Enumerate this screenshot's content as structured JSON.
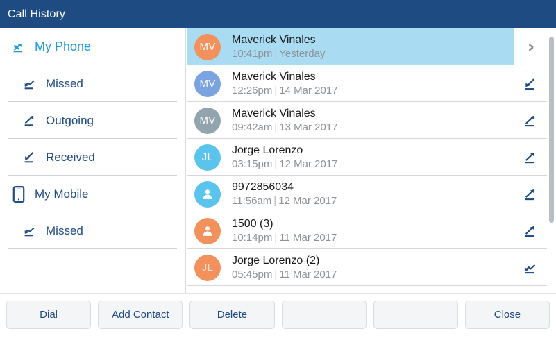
{
  "window": {
    "title": "Call History"
  },
  "colors": {
    "header_bg": "#1f4b83",
    "accent_blue": "#1e9cd7",
    "nav_text": "#1f4b83",
    "selected_row": "#a9dcf2",
    "avatar_orange": "#f2915c",
    "avatar_blue": "#7ba3e0",
    "avatar_gray": "#92a5ae",
    "avatar_cyan": "#5bc4ec",
    "softkey_text": "#1f4b83"
  },
  "sidebar": {
    "items": [
      {
        "label": "My Phone",
        "icon": "all-calls-icon",
        "indent": false,
        "selected": true
      },
      {
        "label": "Missed",
        "icon": "missed-call-icon",
        "indent": true,
        "selected": false
      },
      {
        "label": "Outgoing",
        "icon": "outgoing-call-icon",
        "indent": true,
        "selected": false
      },
      {
        "label": "Received",
        "icon": "received-call-icon",
        "indent": true,
        "selected": false
      },
      {
        "label": "My Mobile",
        "icon": "mobile-phone-icon",
        "indent": false,
        "selected": false
      },
      {
        "label": "Missed",
        "icon": "missed-call-icon",
        "indent": true,
        "selected": false
      }
    ]
  },
  "call_list": {
    "rows": [
      {
        "name": "Maverick Vinales",
        "time": "10:41pm",
        "date": "Yesterday",
        "initials": "MV",
        "avatar_type": "initials",
        "avatar_color": "#f2915c",
        "action_icon": "chevron-right-icon",
        "selected": true
      },
      {
        "name": "Maverick Vinales",
        "time": "12:26pm",
        "date": "14 Mar 2017",
        "initials": "MV",
        "avatar_type": "initials",
        "avatar_color": "#7ba3e0",
        "action_icon": "received-call-icon",
        "selected": false
      },
      {
        "name": "Maverick Vinales",
        "time": "09:42am",
        "date": "13 Mar 2017",
        "initials": "MV",
        "avatar_type": "initials",
        "avatar_color": "#92a5ae",
        "action_icon": "outgoing-call-icon",
        "selected": false
      },
      {
        "name": "Jorge Lorenzo",
        "time": "03:15pm",
        "date": "12 Mar 2017",
        "initials": "JL",
        "avatar_type": "initials",
        "avatar_color": "#5bc4ec",
        "action_icon": "outgoing-call-icon",
        "selected": false
      },
      {
        "name": "9972856034",
        "time": "11:56am",
        "date": "12 Mar 2017",
        "initials": "",
        "avatar_type": "person",
        "avatar_color": "#5bc4ec",
        "action_icon": "outgoing-call-icon",
        "selected": false
      },
      {
        "name": "1500 (3)",
        "time": "10:14pm",
        "date": "11 Mar 2017",
        "initials": "",
        "avatar_type": "person",
        "avatar_color": "#f2915c",
        "action_icon": "outgoing-call-icon",
        "selected": false
      },
      {
        "name": "Jorge Lorenzo (2)",
        "time": "05:45pm",
        "date": "11 Mar 2017",
        "initials": "JL",
        "avatar_type": "initials",
        "avatar_color": "#f2915c",
        "action_icon": "missed-call-icon",
        "selected": false
      }
    ],
    "separator": "|"
  },
  "softkeys": [
    {
      "label": "Dial"
    },
    {
      "label": "Add Contact"
    },
    {
      "label": "Delete"
    },
    {
      "label": ""
    },
    {
      "label": ""
    },
    {
      "label": "Close"
    }
  ]
}
